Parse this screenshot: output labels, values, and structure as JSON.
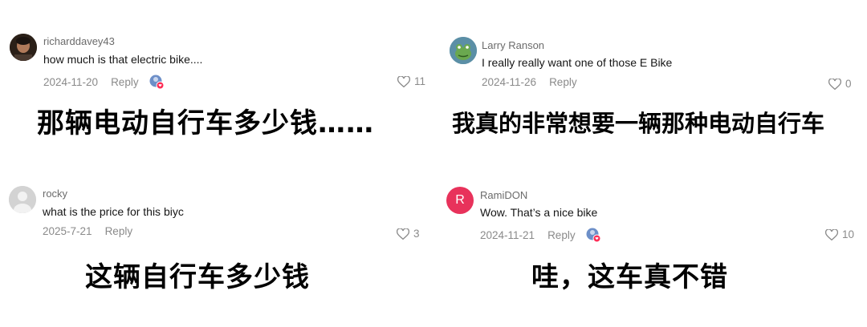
{
  "comments": [
    {
      "username": "richarddavey43",
      "text": "how much is that electric bike....",
      "date": "2024-11-20",
      "reply": "Reply",
      "likes": "11",
      "caption": "那辆电动自行车多少钱……"
    },
    {
      "username": "Larry Ranson",
      "text": "I really really want one of those E Bike",
      "date": "2024-11-26",
      "reply": "Reply",
      "likes": "0",
      "caption": "我真的非常想要一辆那种电动自行车"
    },
    {
      "username": "rocky",
      "text": "what is the price for this biyc",
      "date": "2025-7-21",
      "reply": "Reply",
      "likes": "3",
      "caption": "这辆自行车多少钱"
    },
    {
      "username": "RamiDON",
      "avatar_letter": "R",
      "text": "Wow. That’s a nice bike",
      "date": "2024-11-21",
      "reply": "Reply",
      "likes": "10",
      "caption": "哇，这车真不错"
    }
  ],
  "colors": {
    "rami_avatar": "#e8325b",
    "larry_avatar": "#5b8fa6",
    "default_avatar": "#d3d3d3",
    "muted_text": "#8a8a8a",
    "like_badge": "#fe2c55"
  },
  "icons": [
    "heart-outline-icon",
    "creator-liked-badge-icon",
    "default-avatar-icon"
  ]
}
